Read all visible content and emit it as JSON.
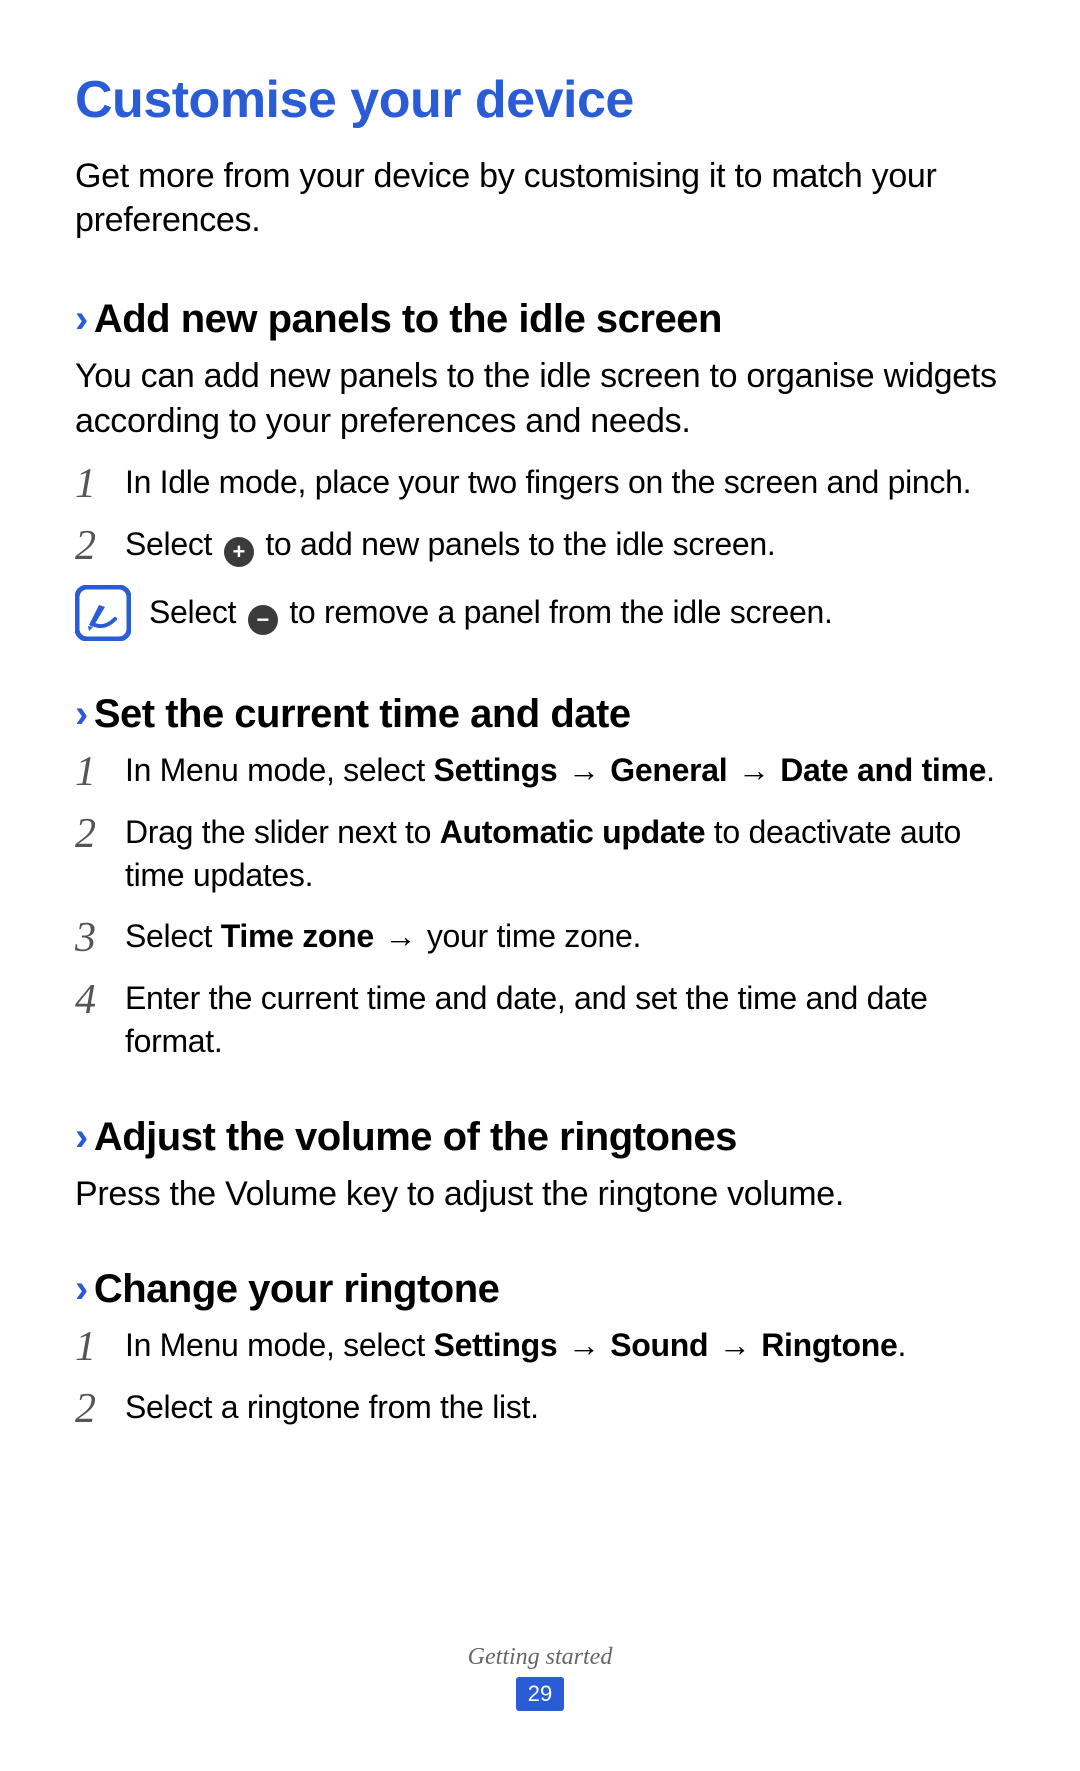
{
  "title": "Customise your device",
  "intro": "Get more from your device by customising it to match your preferences.",
  "sections": {
    "panels": {
      "heading": "Add new panels to the idle screen",
      "desc": "You can add new panels to the idle screen to organise widgets according to your preferences and needs.",
      "step1": "In Idle mode, place your two fingers on the screen and pinch.",
      "step2_a": "Select ",
      "step2_b": " to add new panels to the idle screen.",
      "note_a": "Select ",
      "note_b": " to remove a panel from the idle screen."
    },
    "time": {
      "heading": "Set the current time and date",
      "step1_a": "In Menu mode, select ",
      "step1_settings": "Settings",
      "step1_general": "General",
      "step1_date": "Date and time",
      "step1_dot": ".",
      "step2_a": "Drag the slider next to ",
      "step2_b": "Automatic update",
      "step2_c": " to deactivate auto time updates.",
      "step3_a": "Select ",
      "step3_b": "Time zone",
      "step3_c": " your time zone.",
      "step4": "Enter the current time and date, and set the time and date format."
    },
    "volume": {
      "heading": "Adjust the volume of the ringtones",
      "desc": "Press the Volume key to adjust the ringtone volume."
    },
    "ringtone": {
      "heading": "Change your ringtone",
      "step1_a": "In Menu mode, select ",
      "step1_settings": "Settings",
      "step1_sound": "Sound",
      "step1_ring": "Ringtone",
      "step1_dot": ".",
      "step2": "Select a ringtone from the list."
    }
  },
  "nums": {
    "n1": "1",
    "n2": "2",
    "n3": "3",
    "n4": "4"
  },
  "glyphs": {
    "chev": "›",
    "arrow": "→",
    "plus": "+",
    "minus": "−"
  },
  "footer": {
    "label": "Getting started",
    "page": "29"
  }
}
